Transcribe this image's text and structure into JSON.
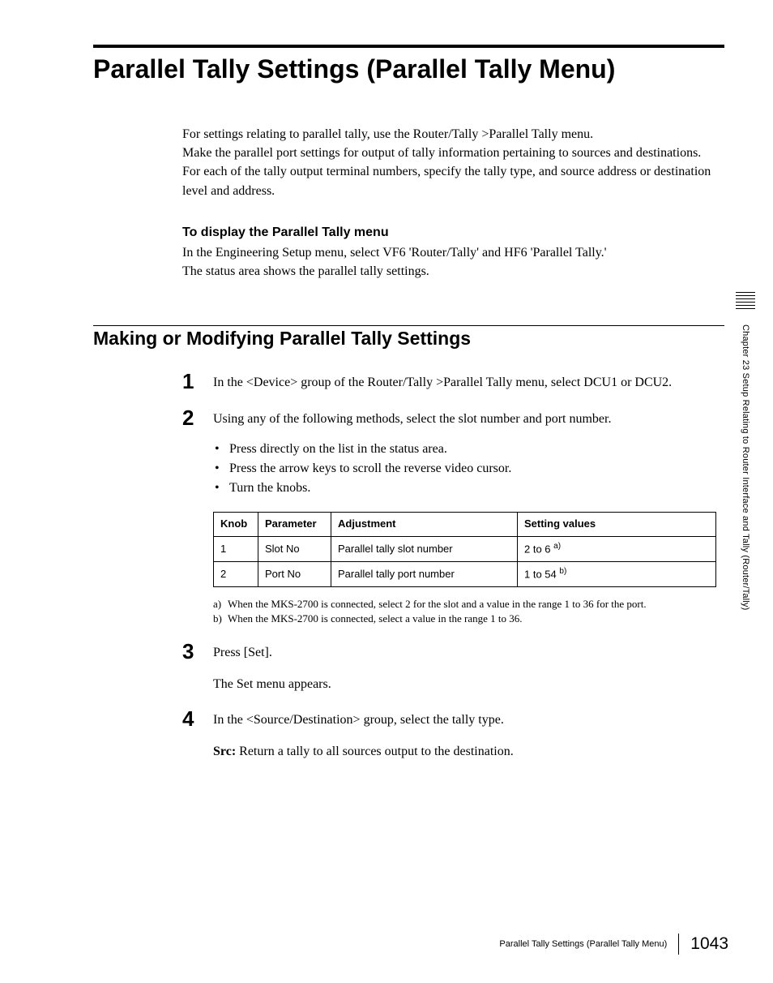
{
  "title": "Parallel Tally Settings (Parallel Tally Menu)",
  "intro": {
    "p1": "For settings relating to parallel tally, use the Router/Tally >Parallel Tally menu.",
    "p2": "Make the parallel port settings for output of tally information pertaining to sources and destinations.",
    "p3": "For each of the tally output terminal numbers, specify the tally type, and source address or destination level and address."
  },
  "display": {
    "heading": "To display the Parallel Tally menu",
    "p1": "In the Engineering Setup menu, select VF6 'Router/Tally' and HF6 'Parallel Tally.'",
    "p2": "The status area shows the parallel tally settings."
  },
  "section_title": "Making or Modifying Parallel Tally Settings",
  "steps": {
    "s1": {
      "num": "1",
      "text": "In the <Device> group of the Router/Tally >Parallel Tally menu, select DCU1 or DCU2."
    },
    "s2": {
      "num": "2",
      "text": "Using any of the following methods, select the slot number and port number.",
      "bullets": {
        "b1": "Press directly on the list in the status area.",
        "b2": "Press the arrow keys to scroll the reverse video cursor.",
        "b3": "Turn the knobs."
      },
      "table": {
        "headers": {
          "knob": "Knob",
          "param": "Parameter",
          "adj": "Adjustment",
          "setval": "Setting values"
        },
        "rows": {
          "r1": {
            "knob": "1",
            "param": "Slot No",
            "adj": "Parallel tally slot number",
            "setval": "2 to 6",
            "sup": "a)"
          },
          "r2": {
            "knob": "2",
            "param": "Port No",
            "adj": "Parallel tally port number",
            "setval": "1 to 54",
            "sup": "b)"
          }
        }
      },
      "footnotes": {
        "fa_label": "a)",
        "fa": "When the MKS-2700 is connected, select 2 for the slot and a value in the range 1 to 36 for the port.",
        "fb_label": "b)",
        "fb": "When the MKS-2700 is connected, select a value in the range 1 to 36."
      }
    },
    "s3": {
      "num": "3",
      "text": "Press [Set].",
      "sub": "The Set menu appears."
    },
    "s4": {
      "num": "4",
      "text": "In the <Source/Destination> group, select the tally type.",
      "src_label": "Src:",
      "src_text": " Return a tally to all sources output to the destination."
    }
  },
  "side": {
    "text": "Chapter 23   Setup Relating to Router Interface and Tally (Router/Tally)"
  },
  "footer": {
    "title": "Parallel Tally Settings (Parallel Tally Menu)",
    "page": "1043"
  }
}
